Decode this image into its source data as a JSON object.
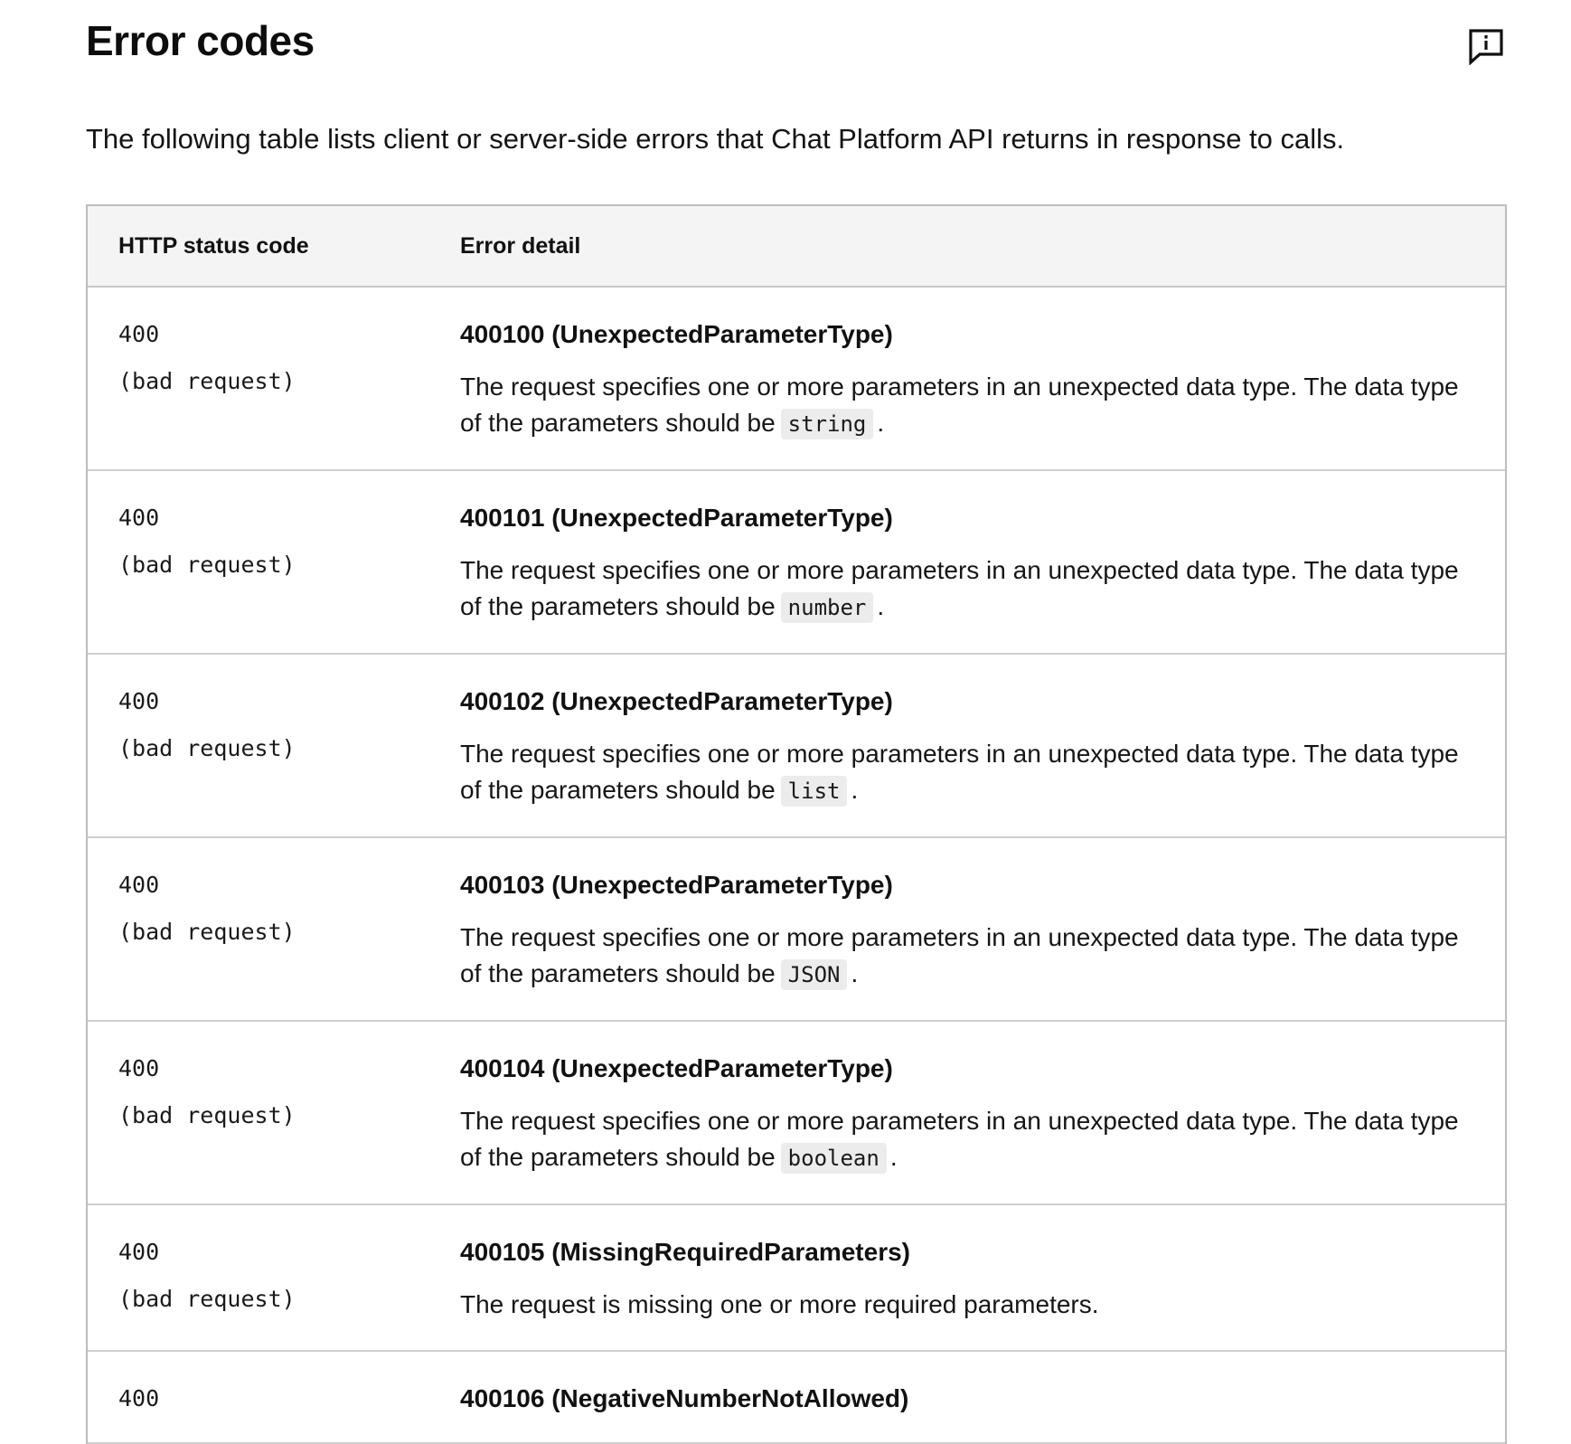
{
  "header": {
    "title": "Error codes",
    "feedback_icon": "feedback-info-icon"
  },
  "intro": "The following table lists client or server-side errors that Chat Platform API returns in response to calls.",
  "table": {
    "columns": [
      "HTTP status code",
      "Error detail"
    ],
    "rows": [
      {
        "status_code": "400",
        "status_text": "(bad request)",
        "title": "400100 (UnexpectedParameterType)",
        "desc_before": "The request specifies one or more parameters in an unexpected data type. The data type of the parameters should be",
        "desc_code": "string",
        "desc_after": "."
      },
      {
        "status_code": "400",
        "status_text": "(bad request)",
        "title": "400101 (UnexpectedParameterType)",
        "desc_before": "The request specifies one or more parameters in an unexpected data type. The data type of the parameters should be",
        "desc_code": "number",
        "desc_after": "."
      },
      {
        "status_code": "400",
        "status_text": "(bad request)",
        "title": "400102 (UnexpectedParameterType)",
        "desc_before": "The request specifies one or more parameters in an unexpected data type. The data type of the parameters should be",
        "desc_code": "list",
        "desc_after": "."
      },
      {
        "status_code": "400",
        "status_text": "(bad request)",
        "title": "400103 (UnexpectedParameterType)",
        "desc_before": "The request specifies one or more parameters in an unexpected data type. The data type of the parameters should be",
        "desc_code": "JSON",
        "desc_after": "."
      },
      {
        "status_code": "400",
        "status_text": "(bad request)",
        "title": "400104 (UnexpectedParameterType)",
        "desc_before": "The request specifies one or more parameters in an unexpected data type. The data type of the parameters should be",
        "desc_code": "boolean",
        "desc_after": "."
      },
      {
        "status_code": "400",
        "status_text": "(bad request)",
        "title": "400105 (MissingRequiredParameters)",
        "desc_before": "The request is missing one or more required parameters.",
        "desc_code": "",
        "desc_after": ""
      },
      {
        "status_code": "400",
        "status_text": "",
        "title": "400106 (NegativeNumberNotAllowed)",
        "desc_before": "",
        "desc_code": "",
        "desc_after": ""
      }
    ]
  }
}
